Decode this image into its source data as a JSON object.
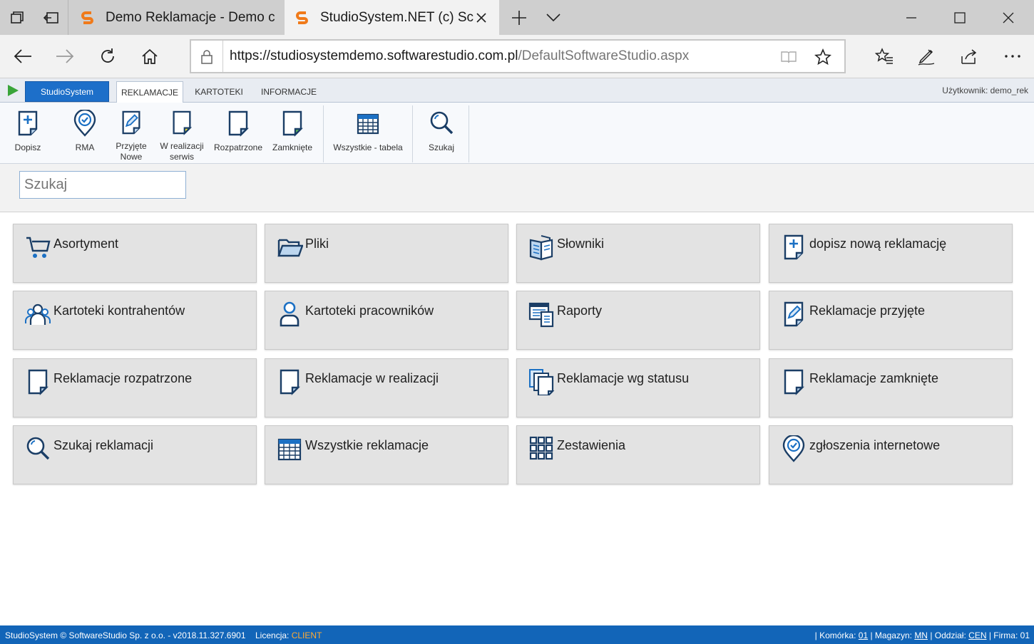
{
  "browser": {
    "tabs": [
      {
        "label": "Demo Reklamacje - Demo c",
        "active": false
      },
      {
        "label": "StudioSystem.NET (c) Sc",
        "active": true
      }
    ],
    "url": "https://studiosystemdemo.softwarestudio.com.pl/DefaultSoftwareStudio.aspx",
    "url_host": "https://studiosystemdemo.softwarestudio.com.pl",
    "url_path": "/DefaultSoftwareStudio.aspx"
  },
  "app": {
    "brand_button": "StudioSystem",
    "tabs": [
      "REKLAMACJE",
      "KARTOTEKI",
      "INFORMACJE"
    ],
    "active_tab": "REKLAMACJE",
    "user_label": "Użytkownik: demo_rek",
    "accent": "#1d6fc9"
  },
  "ribbon": {
    "dopisz": "Dopisz",
    "rma": "RMA",
    "przyjete_1": "Przyjęte",
    "przyjete_2": "Nowe",
    "wreal_1": "W realizacji",
    "wreal_2": "serwis",
    "rozpatrzone": "Rozpatrzone",
    "zamkniete": "Zamknięte",
    "wszystkie": "Wszystkie - tabela",
    "szukaj": "Szukaj"
  },
  "search": {
    "placeholder": "Szukaj"
  },
  "tiles": [
    {
      "label": "Asortyment",
      "icon": "cart-icon"
    },
    {
      "label": "Pliki",
      "icon": "folder-icon"
    },
    {
      "label": "Słowniki",
      "icon": "book-icon"
    },
    {
      "label": "dopisz nową reklamację",
      "icon": "doc-plus-icon"
    },
    {
      "label": "Kartoteki kontrahentów",
      "icon": "group-icon"
    },
    {
      "label": "Kartoteki pracowników",
      "icon": "person-icon"
    },
    {
      "label": "Raporty",
      "icon": "report-icon"
    },
    {
      "label": "Reklamacje przyjęte",
      "icon": "doc-edit-icon"
    },
    {
      "label": "Reklamacje rozpatrzone",
      "icon": "doc-icon"
    },
    {
      "label": "Reklamacje w realizacji",
      "icon": "doc-icon"
    },
    {
      "label": "Reklamacje wg statusu",
      "icon": "docs-icon"
    },
    {
      "label": "Reklamacje zamknięte",
      "icon": "doc-icon"
    },
    {
      "label": "Szukaj reklamacji",
      "icon": "search-icon"
    },
    {
      "label": "Wszystkie reklamacje",
      "icon": "table-icon"
    },
    {
      "label": "Zestawienia",
      "icon": "grid-icon"
    },
    {
      "label": "zgłoszenia internetowe",
      "icon": "pin-check-icon"
    }
  ],
  "status": {
    "left": "StudioSystem © SoftwareStudio Sp. z o.o. - v2018.11.327.6901",
    "license_label": "Licencja:",
    "license_value": "CLIENT",
    "komorka_label": "| Komórka:",
    "komorka_value": "01",
    "magazyn_label": "| Magazyn:",
    "magazyn_value": "MN",
    "oddzial_label": "| Oddział:",
    "oddzial_value": "CEN",
    "firma_label": "| Firma:",
    "firma_value": "01"
  }
}
